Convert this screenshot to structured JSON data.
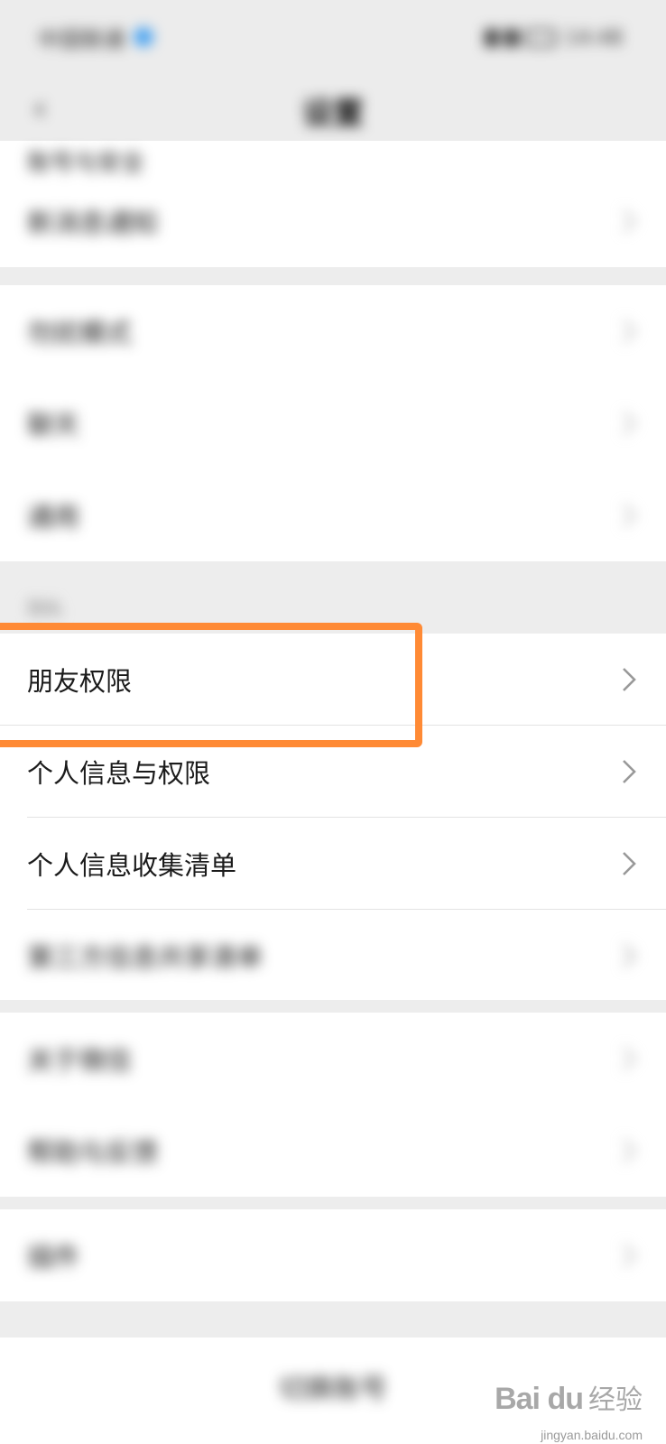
{
  "status_bar": {
    "carrier": "中国联通",
    "time": "14:48"
  },
  "nav": {
    "title": "设置"
  },
  "groups": [
    {
      "items": [
        {
          "label": "新消息通知"
        },
        {
          "label": "聊天"
        }
      ]
    },
    {
      "items": [
        {
          "label": "通用"
        }
      ]
    },
    {
      "header": "隐私",
      "items": [
        {
          "label": "朋友权限"
        },
        {
          "label": "个人信息与权限"
        },
        {
          "label": "个人信息收集清单"
        },
        {
          "label": "第三方信息共享清单"
        }
      ]
    },
    {
      "items": [
        {
          "label": "关于微信"
        },
        {
          "label": "帮助与反馈"
        }
      ]
    },
    {
      "items": [
        {
          "label": "插件"
        }
      ]
    }
  ],
  "top_partial": {
    "label": "账号与安全"
  },
  "mid_group": {
    "items": [
      {
        "label": "勿扰模式"
      },
      {
        "label": "聊天"
      },
      {
        "label": "通用"
      }
    ]
  },
  "logout": {
    "label": "切换账号"
  },
  "watermark": {
    "logo": "Bai du",
    "cn": "经验",
    "url": "jingyan.baidu.com"
  },
  "colors": {
    "highlight": "#ff8a35",
    "background": "#ededed",
    "row": "#ffffff"
  },
  "icons": {
    "back": "chevron-left-icon",
    "row_arrow": "chevron-right-icon"
  }
}
